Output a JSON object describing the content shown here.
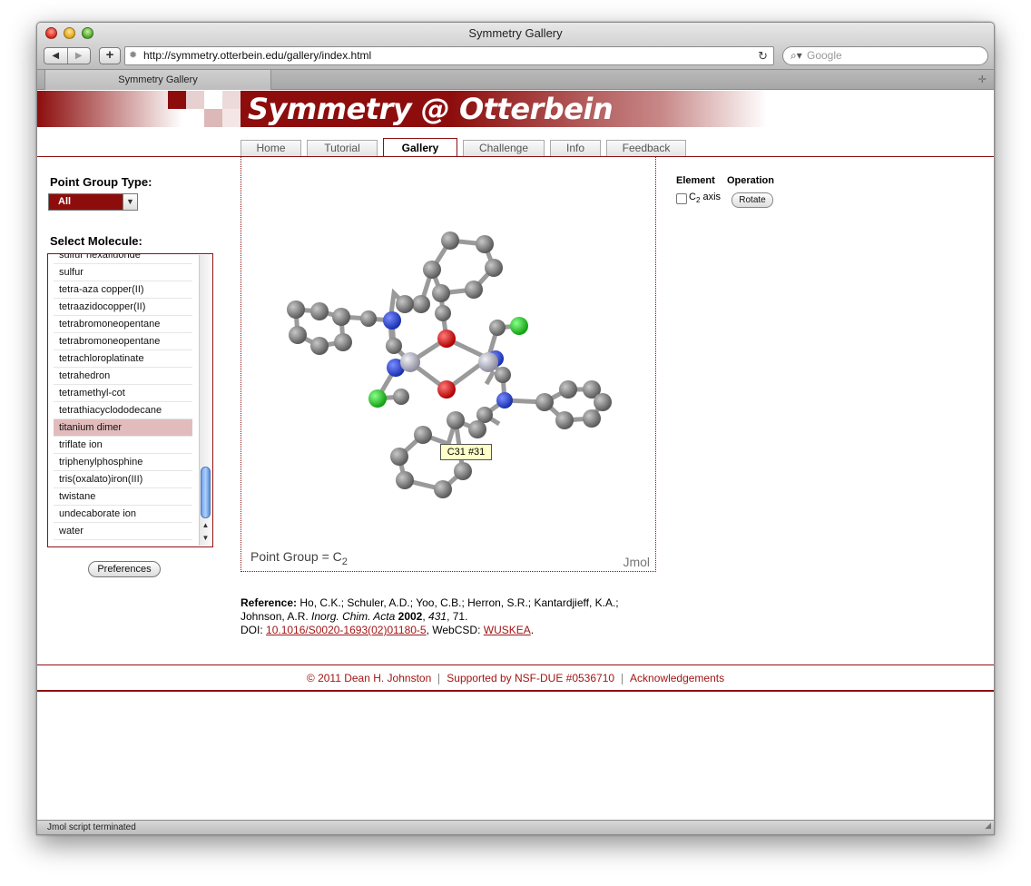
{
  "window": {
    "title": "Symmetry Gallery"
  },
  "toolbar": {
    "back_icon": "◀",
    "forward_icon": "▶",
    "add_icon": "+",
    "url": "http://symmetry.otterbein.edu/gallery/index.html",
    "reload_icon": "↻",
    "search_placeholder": "Google"
  },
  "browser_tab": {
    "label": "Symmetry Gallery"
  },
  "site": {
    "title": "Symmetry @ Otterbein",
    "accent": "#8d0d0d",
    "nav": [
      "Home",
      "Tutorial",
      "Gallery",
      "Challenge",
      "Info",
      "Feedback"
    ],
    "active_nav": "Gallery"
  },
  "sidebar": {
    "point_group_label": "Point Group Type:",
    "point_group_value": "All",
    "select_label": "Select Molecule:",
    "molecules": [
      "sulfur hexafluoride",
      "sulfur",
      "tetra-aza copper(II)",
      "tetraazidocopper(II)",
      "tetrabromoneopentane",
      "tetrabromoneopentane",
      "tetrachloroplatinate",
      "tetrahedron",
      "tetramethyl-cot",
      "tetrathiacyclododecane",
      "titanium dimer",
      "triflate ion",
      "triphenylphosphine",
      "tris(oxalato)iron(III)",
      "twistane",
      "undecaborate ion",
      "water"
    ],
    "selected": "titanium dimer",
    "preferences_label": "Preferences"
  },
  "viewer": {
    "point_group_prefix": "Point Group = C",
    "point_group_sub": "2",
    "jmol_label": "Jmol",
    "tooltip": "C31 #31"
  },
  "operations": {
    "element_header": "Element",
    "operation_header": "Operation",
    "element_name": "C",
    "element_sub": "2",
    "element_suffix": " axis",
    "rotate_label": "Rotate"
  },
  "reference": {
    "label": "Reference:",
    "authors": " Ho, C.K.; Schuler, A.D.; Yoo, C.B.; Herron, S.R.; Kantardjieff, K.A.; Johnson, A.R. ",
    "journal": "Inorg. Chim. Acta",
    "year": "2002",
    "volume": "431",
    "page": ", 71.",
    "doi_label": "DOI: ",
    "doi": "10.1016/S0020-1693(02)01180-5",
    "webcsd_label": ", WebCSD: ",
    "webcsd": "WUSKEA",
    "end": "."
  },
  "footer": {
    "copyright": "© 2011 Dean H. Johnston",
    "support": "Supported by NSF-DUE #0536710",
    "ack": "Acknowledgements"
  },
  "status": {
    "text": "Jmol script terminated"
  }
}
